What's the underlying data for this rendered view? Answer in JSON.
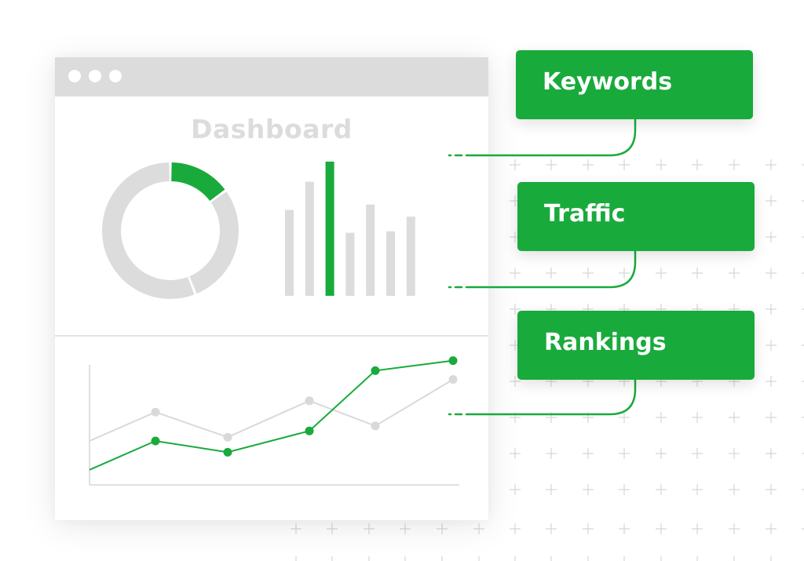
{
  "window": {
    "title": "Dashboard",
    "titlebar_dots": [
      "window-dot",
      "window-dot",
      "window-dot"
    ]
  },
  "colors": {
    "accent": "#19aa3c",
    "muted": "#dcdcdc",
    "muted_line": "#d9d9d9",
    "axis": "#e0e0e0",
    "grid_plus": "#d6d6d6"
  },
  "cards": [
    {
      "label": "Keywords"
    },
    {
      "label": "Traffic"
    },
    {
      "label": "Rankings"
    }
  ],
  "chart_data": [
    {
      "type": "pie",
      "variant": "donut",
      "title": "",
      "values": [
        15,
        29,
        56
      ],
      "highlight_index": 0,
      "labels": []
    },
    {
      "type": "bar",
      "title": "",
      "categories": [
        "1",
        "2",
        "3",
        "4",
        "5",
        "6",
        "7"
      ],
      "values": [
        64,
        85,
        100,
        47,
        68,
        48,
        59
      ],
      "highlight_index": 2,
      "ylim": [
        0,
        100
      ]
    },
    {
      "type": "line",
      "title": "",
      "x": [
        0,
        1,
        2,
        3,
        4,
        5
      ],
      "series": [
        {
          "name": "gray-series",
          "values": [
            35,
            58,
            38,
            67,
            47,
            84
          ]
        },
        {
          "name": "green-series",
          "values": [
            12,
            35,
            26,
            43,
            91,
            99
          ]
        }
      ],
      "ylim": [
        0,
        100
      ],
      "grid": false
    }
  ]
}
